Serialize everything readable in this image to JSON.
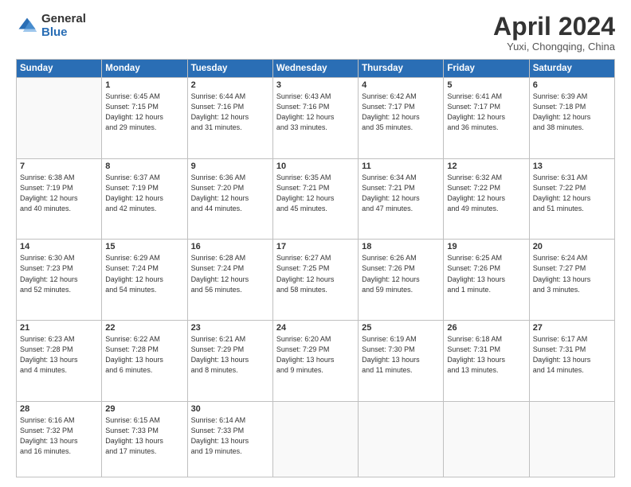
{
  "logo": {
    "general": "General",
    "blue": "Blue"
  },
  "title": "April 2024",
  "subtitle": "Yuxi, Chongqing, China",
  "headers": [
    "Sunday",
    "Monday",
    "Tuesday",
    "Wednesday",
    "Thursday",
    "Friday",
    "Saturday"
  ],
  "weeks": [
    [
      {
        "day": "",
        "info": ""
      },
      {
        "day": "1",
        "info": "Sunrise: 6:45 AM\nSunset: 7:15 PM\nDaylight: 12 hours\nand 29 minutes."
      },
      {
        "day": "2",
        "info": "Sunrise: 6:44 AM\nSunset: 7:16 PM\nDaylight: 12 hours\nand 31 minutes."
      },
      {
        "day": "3",
        "info": "Sunrise: 6:43 AM\nSunset: 7:16 PM\nDaylight: 12 hours\nand 33 minutes."
      },
      {
        "day": "4",
        "info": "Sunrise: 6:42 AM\nSunset: 7:17 PM\nDaylight: 12 hours\nand 35 minutes."
      },
      {
        "day": "5",
        "info": "Sunrise: 6:41 AM\nSunset: 7:17 PM\nDaylight: 12 hours\nand 36 minutes."
      },
      {
        "day": "6",
        "info": "Sunrise: 6:39 AM\nSunset: 7:18 PM\nDaylight: 12 hours\nand 38 minutes."
      }
    ],
    [
      {
        "day": "7",
        "info": "Sunrise: 6:38 AM\nSunset: 7:19 PM\nDaylight: 12 hours\nand 40 minutes."
      },
      {
        "day": "8",
        "info": "Sunrise: 6:37 AM\nSunset: 7:19 PM\nDaylight: 12 hours\nand 42 minutes."
      },
      {
        "day": "9",
        "info": "Sunrise: 6:36 AM\nSunset: 7:20 PM\nDaylight: 12 hours\nand 44 minutes."
      },
      {
        "day": "10",
        "info": "Sunrise: 6:35 AM\nSunset: 7:21 PM\nDaylight: 12 hours\nand 45 minutes."
      },
      {
        "day": "11",
        "info": "Sunrise: 6:34 AM\nSunset: 7:21 PM\nDaylight: 12 hours\nand 47 minutes."
      },
      {
        "day": "12",
        "info": "Sunrise: 6:32 AM\nSunset: 7:22 PM\nDaylight: 12 hours\nand 49 minutes."
      },
      {
        "day": "13",
        "info": "Sunrise: 6:31 AM\nSunset: 7:22 PM\nDaylight: 12 hours\nand 51 minutes."
      }
    ],
    [
      {
        "day": "14",
        "info": "Sunrise: 6:30 AM\nSunset: 7:23 PM\nDaylight: 12 hours\nand 52 minutes."
      },
      {
        "day": "15",
        "info": "Sunrise: 6:29 AM\nSunset: 7:24 PM\nDaylight: 12 hours\nand 54 minutes."
      },
      {
        "day": "16",
        "info": "Sunrise: 6:28 AM\nSunset: 7:24 PM\nDaylight: 12 hours\nand 56 minutes."
      },
      {
        "day": "17",
        "info": "Sunrise: 6:27 AM\nSunset: 7:25 PM\nDaylight: 12 hours\nand 58 minutes."
      },
      {
        "day": "18",
        "info": "Sunrise: 6:26 AM\nSunset: 7:26 PM\nDaylight: 12 hours\nand 59 minutes."
      },
      {
        "day": "19",
        "info": "Sunrise: 6:25 AM\nSunset: 7:26 PM\nDaylight: 13 hours\nand 1 minute."
      },
      {
        "day": "20",
        "info": "Sunrise: 6:24 AM\nSunset: 7:27 PM\nDaylight: 13 hours\nand 3 minutes."
      }
    ],
    [
      {
        "day": "21",
        "info": "Sunrise: 6:23 AM\nSunset: 7:28 PM\nDaylight: 13 hours\nand 4 minutes."
      },
      {
        "day": "22",
        "info": "Sunrise: 6:22 AM\nSunset: 7:28 PM\nDaylight: 13 hours\nand 6 minutes."
      },
      {
        "day": "23",
        "info": "Sunrise: 6:21 AM\nSunset: 7:29 PM\nDaylight: 13 hours\nand 8 minutes."
      },
      {
        "day": "24",
        "info": "Sunrise: 6:20 AM\nSunset: 7:29 PM\nDaylight: 13 hours\nand 9 minutes."
      },
      {
        "day": "25",
        "info": "Sunrise: 6:19 AM\nSunset: 7:30 PM\nDaylight: 13 hours\nand 11 minutes."
      },
      {
        "day": "26",
        "info": "Sunrise: 6:18 AM\nSunset: 7:31 PM\nDaylight: 13 hours\nand 13 minutes."
      },
      {
        "day": "27",
        "info": "Sunrise: 6:17 AM\nSunset: 7:31 PM\nDaylight: 13 hours\nand 14 minutes."
      }
    ],
    [
      {
        "day": "28",
        "info": "Sunrise: 6:16 AM\nSunset: 7:32 PM\nDaylight: 13 hours\nand 16 minutes."
      },
      {
        "day": "29",
        "info": "Sunrise: 6:15 AM\nSunset: 7:33 PM\nDaylight: 13 hours\nand 17 minutes."
      },
      {
        "day": "30",
        "info": "Sunrise: 6:14 AM\nSunset: 7:33 PM\nDaylight: 13 hours\nand 19 minutes."
      },
      {
        "day": "",
        "info": ""
      },
      {
        "day": "",
        "info": ""
      },
      {
        "day": "",
        "info": ""
      },
      {
        "day": "",
        "info": ""
      }
    ]
  ]
}
